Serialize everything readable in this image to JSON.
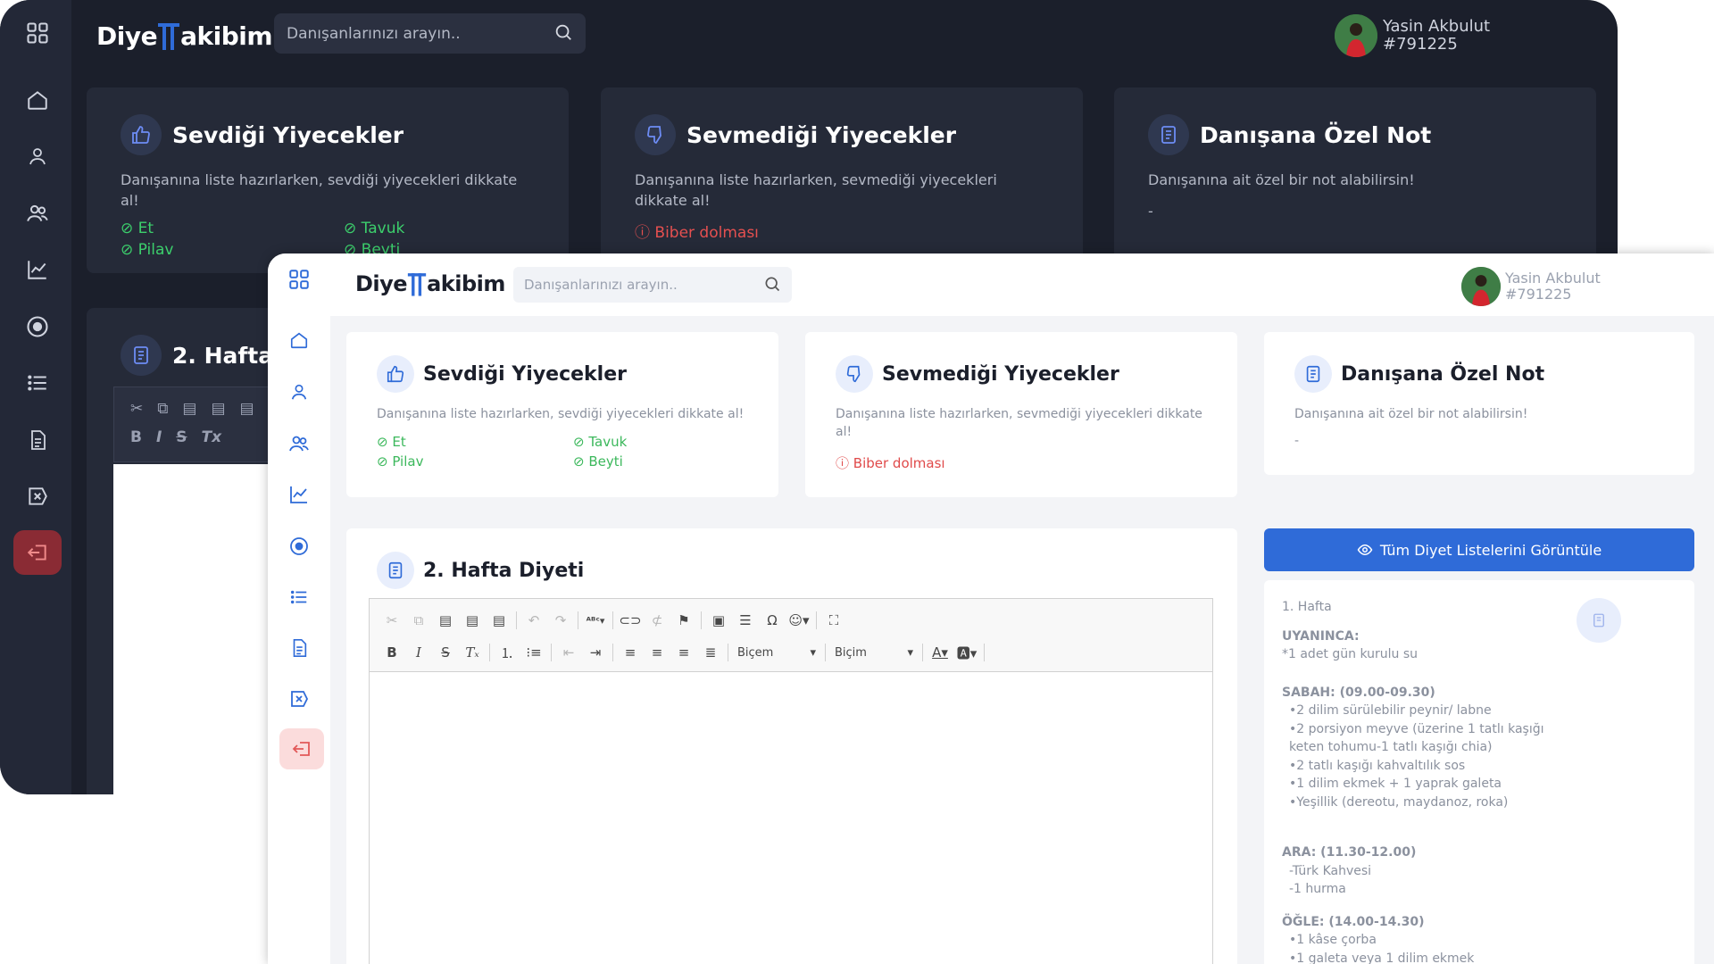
{
  "brand": {
    "pre": "Diye",
    "post": "akibim"
  },
  "search": {
    "placeholder": "Danışanlarınızı arayın.."
  },
  "user": {
    "name": "Yasin Akbulut",
    "id": "#791225"
  },
  "sidebar_icons": [
    "grid-icon",
    "home-icon",
    "user-icon",
    "users-icon",
    "chart-icon",
    "target-icon",
    "list-icon",
    "document-icon",
    "x-square-icon",
    "logout-icon"
  ],
  "cards": {
    "liked": {
      "title": "Sevdiği Yiyecekler",
      "desc": "Danışanına liste hazırlarken, sevdiği yiyecekleri dikkate al!",
      "items": [
        "Et",
        "Tavuk",
        "Pilav",
        "Beyti"
      ]
    },
    "disliked": {
      "title": "Sevmediği Yiyecekler",
      "desc": "Danışanına liste hazırlarken, sevmediği yiyecekleri dikkate al!",
      "items": [
        "Biber dolması"
      ]
    },
    "note": {
      "title": "Danışana Özel Not",
      "desc": "Danışanına ait özel bir not alabilirsin!",
      "value": "-"
    }
  },
  "diet": {
    "title": "2. Hafta Diyeti",
    "dark_title": "2. Hafta D"
  },
  "editor": {
    "format_label": "Biçem",
    "style_label": "Biçim"
  },
  "view_all_button": "Tüm Diyet Listelerini Görüntüle",
  "diet_list": {
    "week": "1. Hafta",
    "sections": [
      {
        "heading": "UYANINCA:",
        "items": [
          "*1 adet gün kurulu su"
        ]
      },
      {
        "heading": "SABAH: (09.00-09.30)",
        "items": [
          "•2 dilim sürülebilir peynir/ labne",
          "•2 porsiyon meyve (üzerine 1 tatlı kaşığı keten tohumu-1 tatlı kaşığı chia)",
          "•2 tatlı kaşığı kahvaltılık sos",
          "•1 dilim ekmek + 1 yaprak galeta",
          "•Yeşillik (dereotu, maydanoz, roka)"
        ]
      },
      {
        "heading": "ARA: (11.30-12.00)",
        "items": [
          "-Türk Kahvesi",
          "-1 hurma"
        ]
      },
      {
        "heading": "ÖĞLE: (14.00-14.30)",
        "items": [
          "•1 kâse çorba",
          "•1 galeta veya 1 dilim ekmek"
        ]
      }
    ]
  },
  "colors": {
    "accent": "#2f6bd8",
    "positive": "#3cb85c",
    "negative": "#e04a4a",
    "dark_bg": "#1b1f2b",
    "logout_bg": "#fbdcdc"
  }
}
